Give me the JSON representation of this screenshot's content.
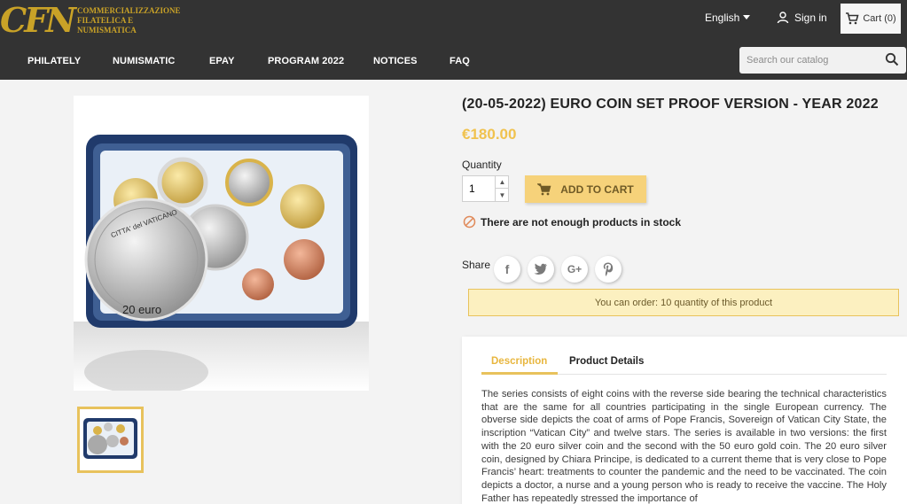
{
  "brand": {
    "mark": "CFN",
    "name_lines": [
      "COMMERCIALIZZAZIONE",
      "FILATELICA E",
      "NUMISMATICA"
    ],
    "color": "#c9a227"
  },
  "header": {
    "language": "English",
    "sign_in": "Sign in",
    "cart": "Cart (0)"
  },
  "nav": {
    "items": [
      "PHILATELY",
      "NUMISMATIC",
      "EPAY",
      "PROGRAM 2022",
      "NOTICES",
      "FAQ"
    ]
  },
  "search": {
    "placeholder": "Search our catalog"
  },
  "image": {
    "coin_label": "20 euro",
    "inscription": "CITTA' del VATICANO"
  },
  "product": {
    "title": "(20-05-2022) EURO COIN SET PROOF VERSION - YEAR 2022",
    "price": "€180.00",
    "quantity_label": "Quantity",
    "quantity_value": "1",
    "add_to_cart": "ADD TO CART",
    "stock_message": "There are not enough products in stock",
    "share_label": "Share",
    "order_notice": "You can order: 10 quantity of this product"
  },
  "tabs": {
    "description": "Description",
    "details": "Product Details",
    "description_text": "The series consists of eight coins with the reverse side bearing the technical characteristics that are the same for all countries participating in the single European currency. The obverse side depicts the coat of arms of Pope Francis, Sovereign of Vatican City State, the inscription “Vatican City” and twelve stars. The series is available in two versions: the first with the 20 euro silver coin and the second with the 50 euro gold coin. The 20 euro silver coin, designed by Chiara Principe, is dedicated to a current theme that is very close to Pope Francis’ heart: treatments to counter the pandemic and the need to be vaccinated. The coin depicts a doctor, a nurse and a young person who is ready to receive the vaccine. The Holy Father has repeatedly stressed the importance of"
  },
  "colors": {
    "header_bg": "#333333",
    "accent": "#f0c24e",
    "button_bg": "#f6d27a",
    "notice_bg": "#fcf0c0"
  }
}
